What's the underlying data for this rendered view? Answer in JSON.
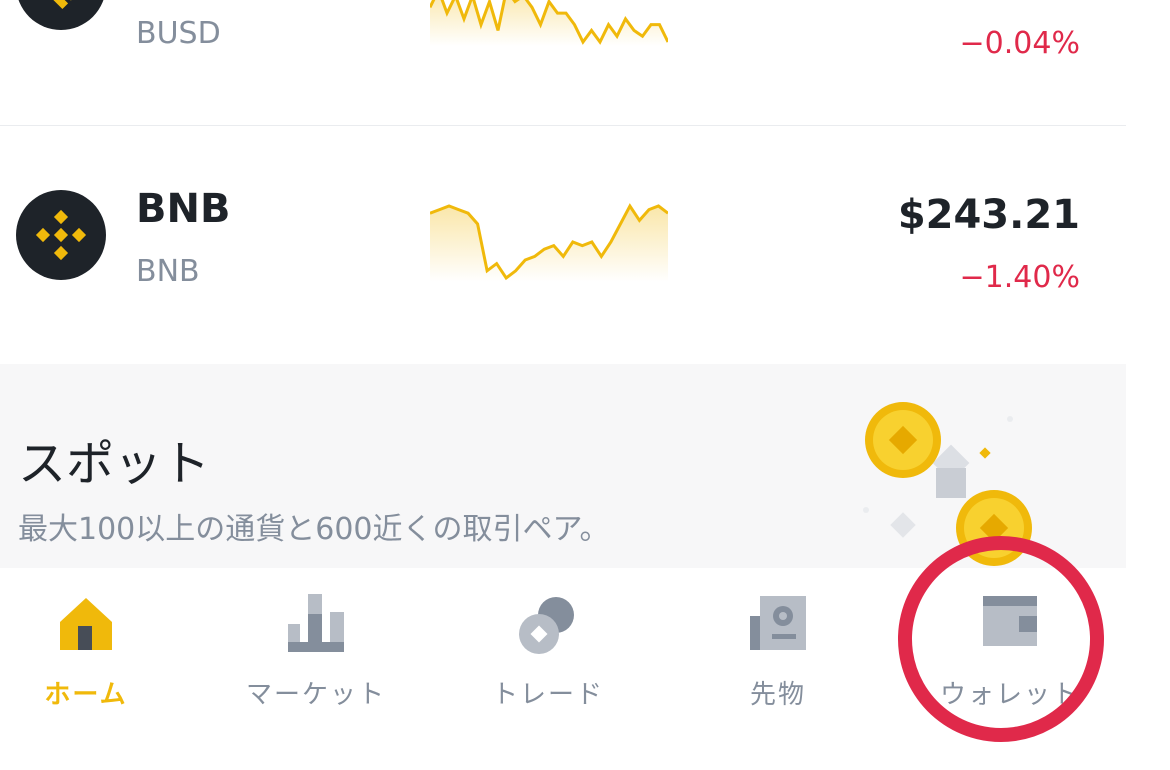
{
  "assets": [
    {
      "name": "",
      "symbol": "BUSD",
      "price": "",
      "change": "−0.04%",
      "icon": "busd-logo-icon",
      "trend": [
        6,
        9,
        5,
        8,
        4,
        8,
        3,
        7,
        2,
        9,
        7,
        8,
        6,
        3,
        7,
        5,
        5,
        3,
        0,
        2,
        0,
        3,
        1,
        4,
        2,
        1,
        3,
        3,
        0
      ]
    },
    {
      "name": "BNB",
      "symbol": "BNB",
      "price": "$243.21",
      "change": "−1.40%",
      "icon": "bnb-logo-icon",
      "trend": [
        9,
        9.5,
        10,
        9.5,
        9,
        7.5,
        1,
        2,
        0,
        1,
        2.5,
        3,
        4,
        4.5,
        3,
        5,
        4.5,
        5,
        3,
        5,
        7.5,
        10,
        8,
        9.5,
        10,
        9
      ]
    }
  ],
  "banner": {
    "title": "スポット",
    "description": "最大100以上の通貨と600近くの取引ペア。"
  },
  "tabs": [
    {
      "label": "ホーム",
      "icon": "home-icon",
      "active": true
    },
    {
      "label": "マーケット",
      "icon": "markets-bar-chart-icon",
      "active": false
    },
    {
      "label": "トレード",
      "icon": "trade-coins-icon",
      "active": false
    },
    {
      "label": "先物",
      "icon": "futures-document-icon",
      "active": false
    },
    {
      "label": "ウォレット",
      "icon": "wallet-icon",
      "active": false
    }
  ],
  "colors": {
    "accent": "#f0b90b",
    "negative": "#e0294a",
    "text": "#1e2329",
    "muted": "#848e9c",
    "highlight_ring": "#e0294a"
  }
}
